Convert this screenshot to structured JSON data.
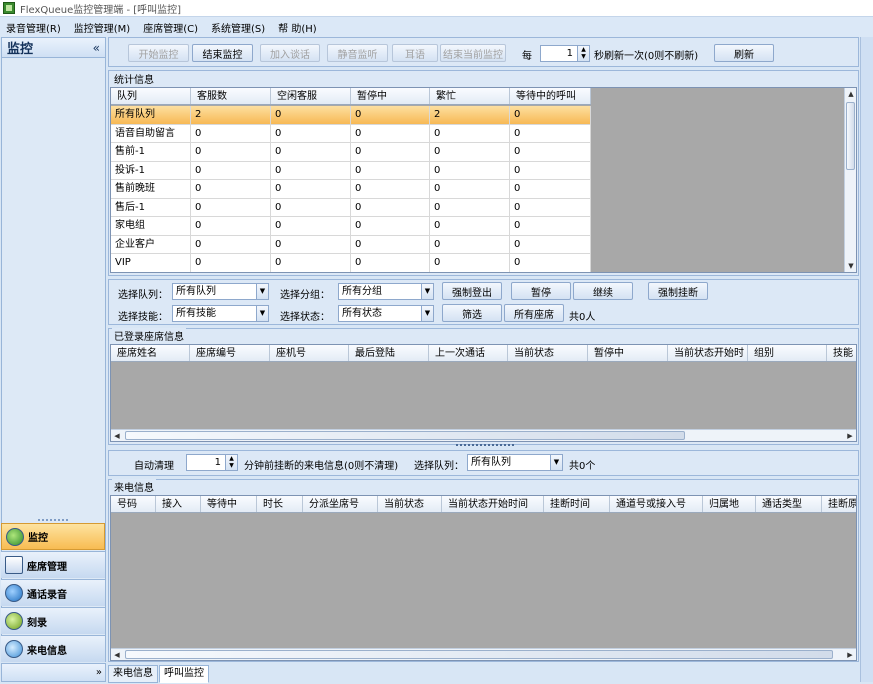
{
  "window": {
    "title": "FlexQueue监控管理端 - [呼叫监控]"
  },
  "menu": [
    "录音管理(R)",
    "监控管理(M)",
    "座席管理(C)",
    "系统管理(S)",
    "帮  助(H)"
  ],
  "left_panel": {
    "title": "监控",
    "collapse": "«",
    "nav": [
      {
        "label": "监控",
        "icon": "monitor-icon",
        "active": true
      },
      {
        "label": "座席管理",
        "icon": "agent-card-icon",
        "active": false
      },
      {
        "label": "通话录音",
        "icon": "play-icon",
        "active": false
      },
      {
        "label": "刻录",
        "icon": "burn-icon",
        "active": false
      },
      {
        "label": "来电信息",
        "icon": "users-icon",
        "active": false
      }
    ],
    "expand": "»"
  },
  "toolbar": {
    "start_monitor": "开始监控",
    "end_monitor": "结束监控",
    "join_call": "加入谈话",
    "silent_monitor": "静音监听",
    "whisper": "耳语",
    "end_current_monitor": "结束当前监控",
    "every_label": "每",
    "refresh_value": "1",
    "refresh_suffix": "秒刷新一次(0则不刷新)",
    "refresh": "刷新"
  },
  "stats": {
    "group_title": "统计信息",
    "columns": [
      "队列",
      "客服数",
      "空闲客服",
      "暂停中",
      "繁忙",
      "等待中的呼叫"
    ],
    "rows": [
      [
        "所有队列",
        "2",
        "0",
        "0",
        "2",
        "0"
      ],
      [
        "语音自助留言",
        "0",
        "0",
        "0",
        "0",
        "0"
      ],
      [
        "售前-1",
        "0",
        "0",
        "0",
        "0",
        "0"
      ],
      [
        "投诉-1",
        "0",
        "0",
        "0",
        "0",
        "0"
      ],
      [
        "售前晚班",
        "0",
        "0",
        "0",
        "0",
        "0"
      ],
      [
        "售后-1",
        "0",
        "0",
        "0",
        "0",
        "0"
      ],
      [
        "家电组",
        "0",
        "0",
        "0",
        "0",
        "0"
      ],
      [
        "企业客户",
        "0",
        "0",
        "0",
        "0",
        "0"
      ],
      [
        "VIP",
        "0",
        "0",
        "0",
        "0",
        "0"
      ]
    ]
  },
  "filters": {
    "queue_label": "选择队列：",
    "queue_value": "所有队列",
    "group_label": "选择分组：",
    "group_value": "所有分组",
    "force_logout": "强制登出",
    "pause": "暂停",
    "resume": "继续",
    "force_hangup": "强制挂断",
    "skill_label": "选择技能：",
    "skill_value": "所有技能",
    "state_label": "选择状态：",
    "state_value": "所有状态",
    "filter": "筛选",
    "all_agents": "所有座席",
    "total": "共0人"
  },
  "agents": {
    "group_title": "已登录座席信息",
    "columns": [
      "座席姓名",
      "座席编号",
      "座机号",
      "最后登陆",
      "上一次通话",
      "当前状态",
      "暂停中",
      "当前状态开始时",
      "组别",
      "技能"
    ]
  },
  "calls_bar": {
    "auto_clear": "自动清理",
    "minutes_value": "1",
    "minutes_suffix": "分钟前挂断的来电信息(0则不清理)",
    "queue_label": "选择队列：",
    "queue_value": "所有队列",
    "total": "共0个"
  },
  "calls": {
    "group_title": "来电信息",
    "columns": [
      "号码",
      "接入",
      "等待中",
      "时长",
      "分派坐席号",
      "当前状态",
      "当前状态开始时间",
      "挂断时间",
      "通道号或接入号",
      "归属地",
      "通话类型",
      "挂断原"
    ]
  },
  "bottom_tabs": [
    "来电信息",
    "呼叫监控"
  ]
}
